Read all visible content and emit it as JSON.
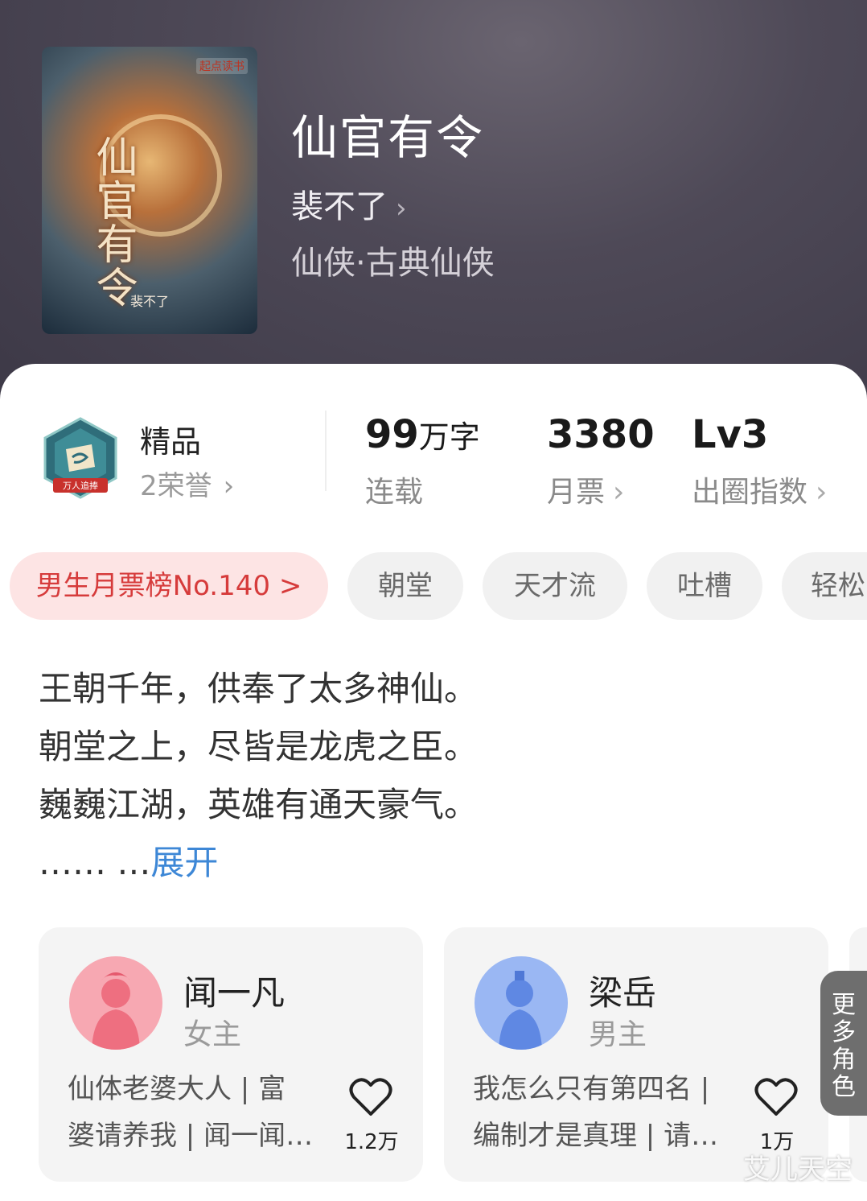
{
  "book": {
    "cover_publisher": "起点读书",
    "cover_title": "仙官有令",
    "cover_author": "裴不了",
    "title": "仙官有令",
    "author": "裴不了",
    "genre": "仙侠·古典仙侠"
  },
  "honor": {
    "badge_text": "万人追捧",
    "level": "精品",
    "count": "2荣誉"
  },
  "stats": [
    {
      "value": "99",
      "unit": "万字",
      "label": "连载"
    },
    {
      "value": "3380",
      "unit": "",
      "label": "月票"
    },
    {
      "value": "Lv3",
      "unit": "",
      "label": "出圈指数"
    }
  ],
  "tags": [
    "男生月票榜No.140 >",
    "朝堂",
    "天才流",
    "吐槽",
    "轻松"
  ],
  "intro": {
    "lines": [
      "王朝千年，供奉了太多神仙。",
      "朝堂之上，尽皆是龙虎之臣。",
      "巍巍江湖，英雄有通天豪气。"
    ],
    "ellipsis": "…… …",
    "expand": "展开"
  },
  "characters": [
    {
      "name": "闻一凡",
      "role": "女主",
      "desc1": "仙体老婆大人 | 富",
      "desc2": "婆请养我 | 闻一闻…",
      "likes": "1.2万"
    },
    {
      "name": "梁岳",
      "role": "男主",
      "desc1": "我怎么只有第四名 |",
      "desc2": "编制才是真理 | 请…",
      "likes": "1万"
    }
  ],
  "more_roles": "更多角色",
  "watermark": "艾儿天空",
  "colors": {
    "rank_chip_bg": "#fde4e4",
    "rank_chip_text": "#d63b3b",
    "expand_link": "#3d87d6",
    "header_bg": "#4e4957"
  }
}
